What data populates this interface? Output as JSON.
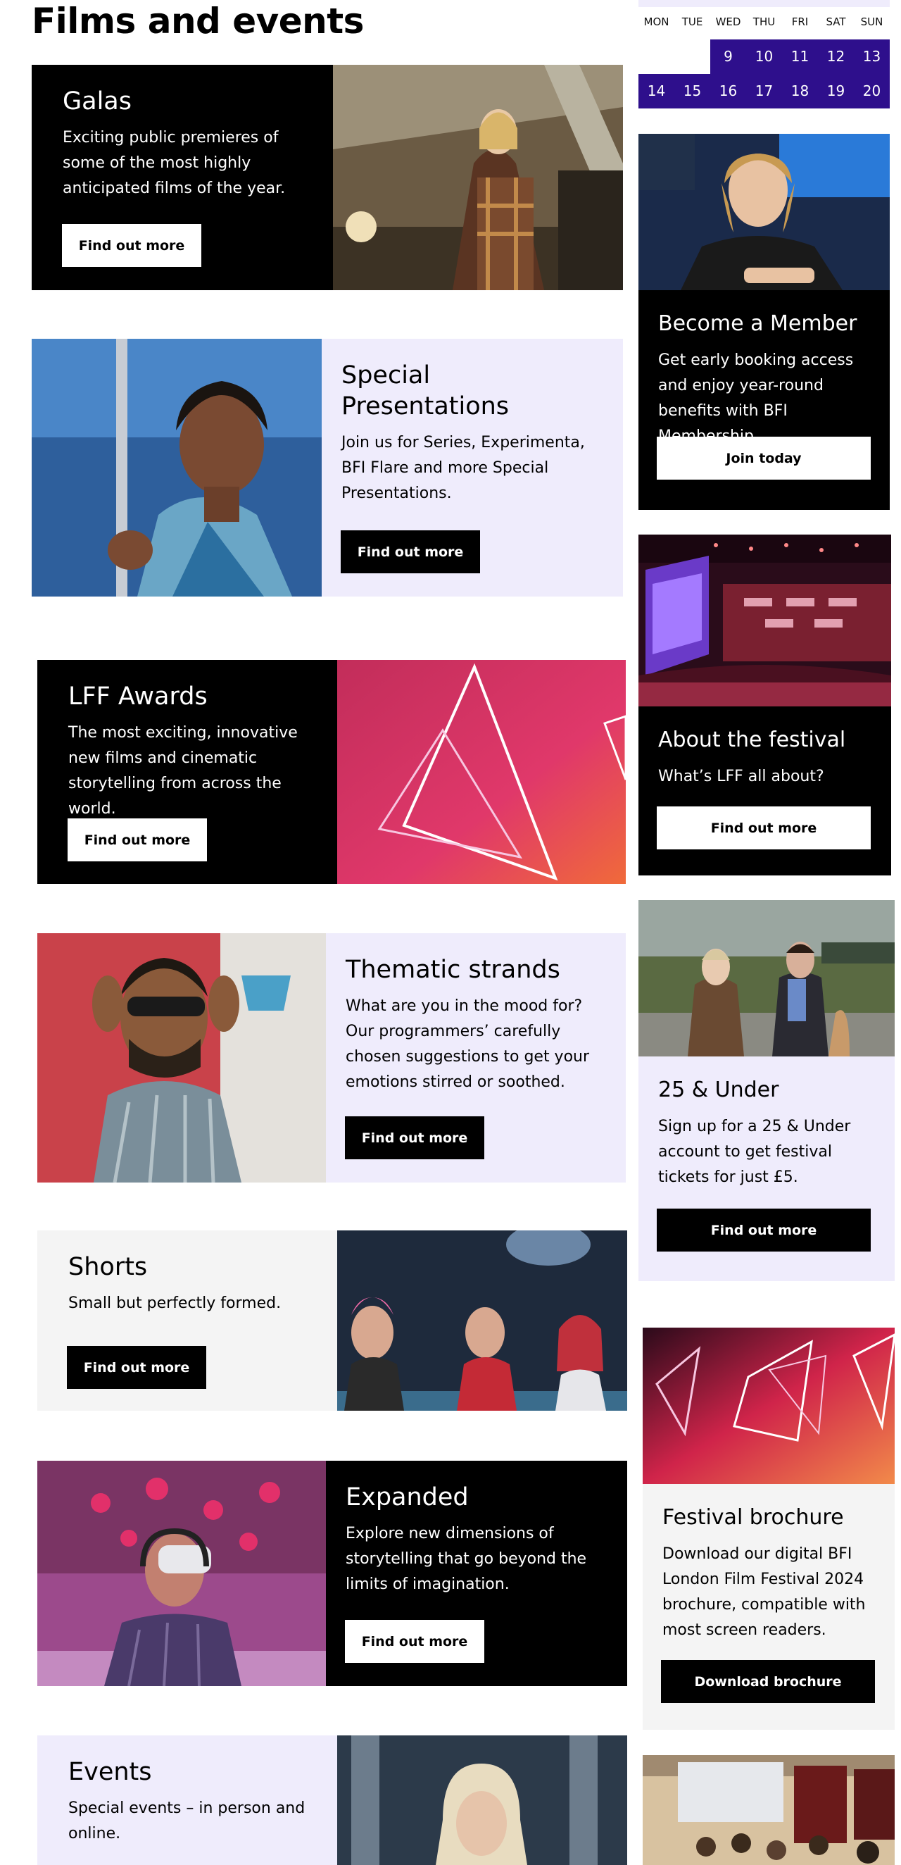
{
  "page": {
    "title": "Films and events"
  },
  "calendar": {
    "days": [
      "MON",
      "TUE",
      "WED",
      "THU",
      "FRI",
      "SAT",
      "SUN"
    ],
    "week1": [
      "",
      "",
      "9",
      "10",
      "11",
      "12",
      "13"
    ],
    "week2": [
      "14",
      "15",
      "16",
      "17",
      "18",
      "19",
      "20"
    ]
  },
  "sections": [
    {
      "title": "Galas",
      "text": "Exciting public premieres of some of the most highly anticipated films of the year.",
      "button": "Find out more"
    },
    {
      "title": "Special Presentations",
      "text": "Join us for Series, Experimenta, BFI Flare and more Special Presentations.",
      "button": "Find out more"
    },
    {
      "title": "LFF Awards",
      "text": "The most exciting, innovative new films and cinematic storytelling from across the world.",
      "button": "Find out more"
    },
    {
      "title": "Thematic strands",
      "text": "What are you in the mood for? Our programmers’ carefully chosen suggestions to get your emotions stirred or soothed.",
      "button": "Find out more"
    },
    {
      "title": "Shorts",
      "text": "Small but perfectly formed.",
      "button": "Find out more"
    },
    {
      "title": "Expanded",
      "text": "Explore new dimensions of storytelling that go beyond the limits of imagination.",
      "button": "Find out more"
    },
    {
      "title": "Events",
      "text": "Special events – in person and online."
    }
  ],
  "sidebar": [
    {
      "title": "Become a Member",
      "text": "Get early booking access and enjoy year-round benefits with BFI Membership.",
      "button": "Join today"
    },
    {
      "title": "About the festival",
      "text": "What’s LFF all about?",
      "button": "Find out more"
    },
    {
      "title": "25 & Under",
      "text": "Sign up for a 25 & Under account to get festival tickets for just £5.",
      "button": "Find out more"
    },
    {
      "title": "Festival brochure",
      "text": "Download our digital BFI London Film Festival 2024 brochure, compatible with most screen readers.",
      "button": "Download brochure"
    }
  ],
  "colors": {
    "black": "#000000",
    "lavender": "#efecfc",
    "grey": "#f4f4f4",
    "calendar_purple": "#2e0f8c"
  }
}
